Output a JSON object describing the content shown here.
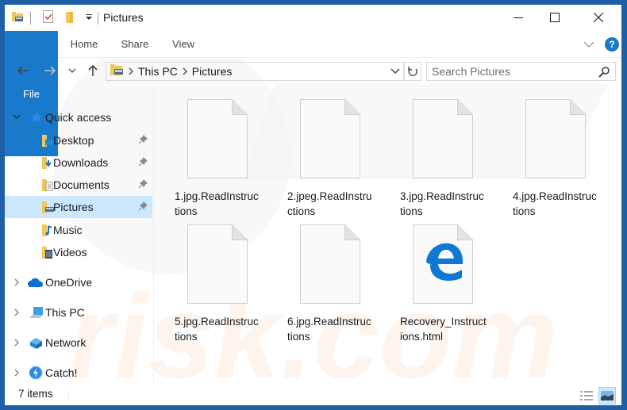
{
  "window": {
    "title": "Pictures",
    "controls": {
      "minimize": "minimize",
      "maximize": "maximize",
      "close": "close"
    }
  },
  "quick_access_toolbar": {
    "icons": [
      "folder-pictures-icon",
      "properties-icon",
      "new-folder-icon",
      "customize-dropdown-icon"
    ]
  },
  "ribbon": {
    "tabs": [
      {
        "label": "File",
        "active": true
      },
      {
        "label": "Home"
      },
      {
        "label": "Share"
      },
      {
        "label": "View"
      }
    ],
    "help_label": "?"
  },
  "navigation": {
    "breadcrumb": [
      "This PC",
      "Pictures"
    ],
    "search_placeholder": "Search Pictures",
    "search_value": ""
  },
  "sidebar": {
    "quick_access": {
      "label": "Quick access",
      "expanded": true
    },
    "pinned": [
      {
        "label": "Desktop",
        "pinned": true,
        "icon": "desktop-folder-icon"
      },
      {
        "label": "Downloads",
        "pinned": true,
        "icon": "downloads-folder-icon"
      },
      {
        "label": "Documents",
        "pinned": true,
        "icon": "documents-folder-icon"
      },
      {
        "label": "Pictures",
        "pinned": true,
        "selected": true,
        "icon": "pictures-folder-icon"
      },
      {
        "label": "Music",
        "pinned": false,
        "icon": "music-folder-icon"
      },
      {
        "label": "Videos",
        "pinned": false,
        "icon": "videos-folder-icon"
      }
    ],
    "roots": [
      {
        "label": "OneDrive",
        "icon": "onedrive-icon"
      },
      {
        "label": "This PC",
        "icon": "this-pc-icon"
      },
      {
        "label": "Network",
        "icon": "network-icon"
      },
      {
        "label": "Catch!",
        "icon": "catch-icon"
      }
    ]
  },
  "files": [
    {
      "name": "1.jpg.ReadInstructions",
      "line1": "1.jpg.ReadInstruc",
      "line2": "tions",
      "type": "blank"
    },
    {
      "name": "2.jpeg.ReadInstructions",
      "line1": "2.jpeg.ReadInstru",
      "line2": "ctions",
      "type": "blank"
    },
    {
      "name": "3.jpg.ReadInstructions",
      "line1": "3.jpg.ReadInstruc",
      "line2": "tions",
      "type": "blank"
    },
    {
      "name": "4.jpg.ReadInstructions",
      "line1": "4.jpg.ReadInstruc",
      "line2": "tions",
      "type": "blank"
    },
    {
      "name": "5.jpg.ReadInstructions",
      "line1": "5.jpg.ReadInstruc",
      "line2": "tions",
      "type": "blank"
    },
    {
      "name": "6.jpg.ReadInstructions",
      "line1": "6.jpg.ReadInstruc",
      "line2": "tions",
      "type": "blank"
    },
    {
      "name": "Recovery_Instructions.html",
      "line1": "Recovery_Instruct",
      "line2": "ions.html",
      "type": "edge-html"
    }
  ],
  "statusbar": {
    "item_count": "7 items",
    "views": [
      "details-view",
      "large-icons-view"
    ],
    "active_view": "large-icons-view"
  },
  "colors": {
    "window_border": "#1f5fa6",
    "accent": "#1979ca",
    "selection": "#cce8ff",
    "edge_blue": "#0f78d4"
  }
}
